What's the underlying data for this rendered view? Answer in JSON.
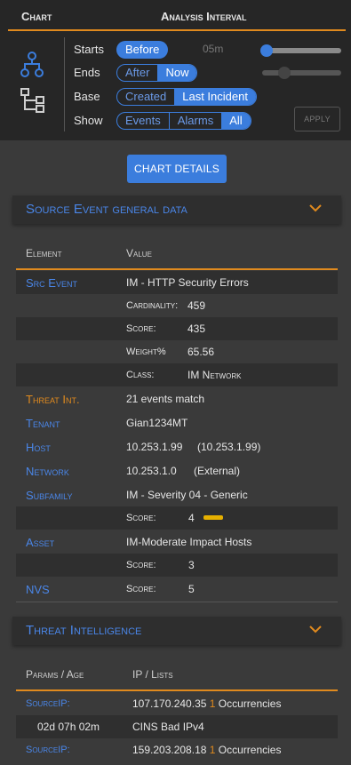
{
  "header": {
    "chart_title": "Chart",
    "interval_title": "Analysis Interval"
  },
  "controls": {
    "starts": {
      "label": "Starts",
      "button": "Before",
      "value": "05m"
    },
    "ends": {
      "label": "Ends",
      "options": [
        "After",
        "Now"
      ],
      "selected": "Now"
    },
    "base": {
      "label": "Base",
      "options": [
        "Created",
        "Last Incident"
      ],
      "selected": "Last Incident"
    },
    "show": {
      "label": "Show",
      "options": [
        "Events",
        "Alarms",
        "All"
      ],
      "selected": "All"
    },
    "apply_label": "APPLY"
  },
  "chart_details_label": "CHART DETAILS",
  "source_event": {
    "title": "Source Event general data",
    "col_element": "Element",
    "col_value": "Value",
    "rows": {
      "src_event": {
        "key": "Src Event",
        "value": "IM - HTTP Security Errors"
      },
      "cardinality": {
        "key": "Cardinality:",
        "value": "459"
      },
      "score": {
        "key": "Score:",
        "value": "435"
      },
      "weight": {
        "key": "Weight%",
        "value": "65.56"
      },
      "class": {
        "key": "Class:",
        "value": "IM Network"
      },
      "threat": {
        "key": "Threat Int.",
        "value": "21 events match"
      },
      "tenant": {
        "key": "Tenant",
        "value": "Gian1234MT"
      },
      "host": {
        "key": "Host",
        "value": "10.253.1.99",
        "extra": "(10.253.1.99)"
      },
      "network": {
        "key": "Network",
        "value": "10.253.1.0",
        "extra": "(External)"
      },
      "subfamily": {
        "key": "Subfamily",
        "value": "IM - Severity 04 - Generic"
      },
      "subfamily_score": {
        "key": "Score:",
        "value": "4"
      },
      "asset": {
        "key": "Asset",
        "value": "IM-Moderate Impact Hosts"
      },
      "asset_score": {
        "key": "Score:",
        "value": "3"
      },
      "nvs": {
        "key": "NVS",
        "sub": "Score:",
        "value": "5"
      }
    }
  },
  "threat_intel": {
    "title": "Threat Intelligence",
    "col_params": "Params / Age",
    "col_ip": "IP / Lists",
    "rows": [
      {
        "key": "SourceIP:",
        "ip": "107.170.240.35",
        "count": "1",
        "suffix": "Occurrencies"
      },
      {
        "age": "02d 07h 02m",
        "list": "CINS Bad IPv4"
      },
      {
        "key": "SourceIP:",
        "ip": "159.203.208.18",
        "count": "1",
        "suffix": "Occurrencies"
      }
    ]
  },
  "colors": {
    "accent": "#3b7ddd",
    "highlight": "#e08a1e",
    "score_bar": "#e6b000"
  }
}
